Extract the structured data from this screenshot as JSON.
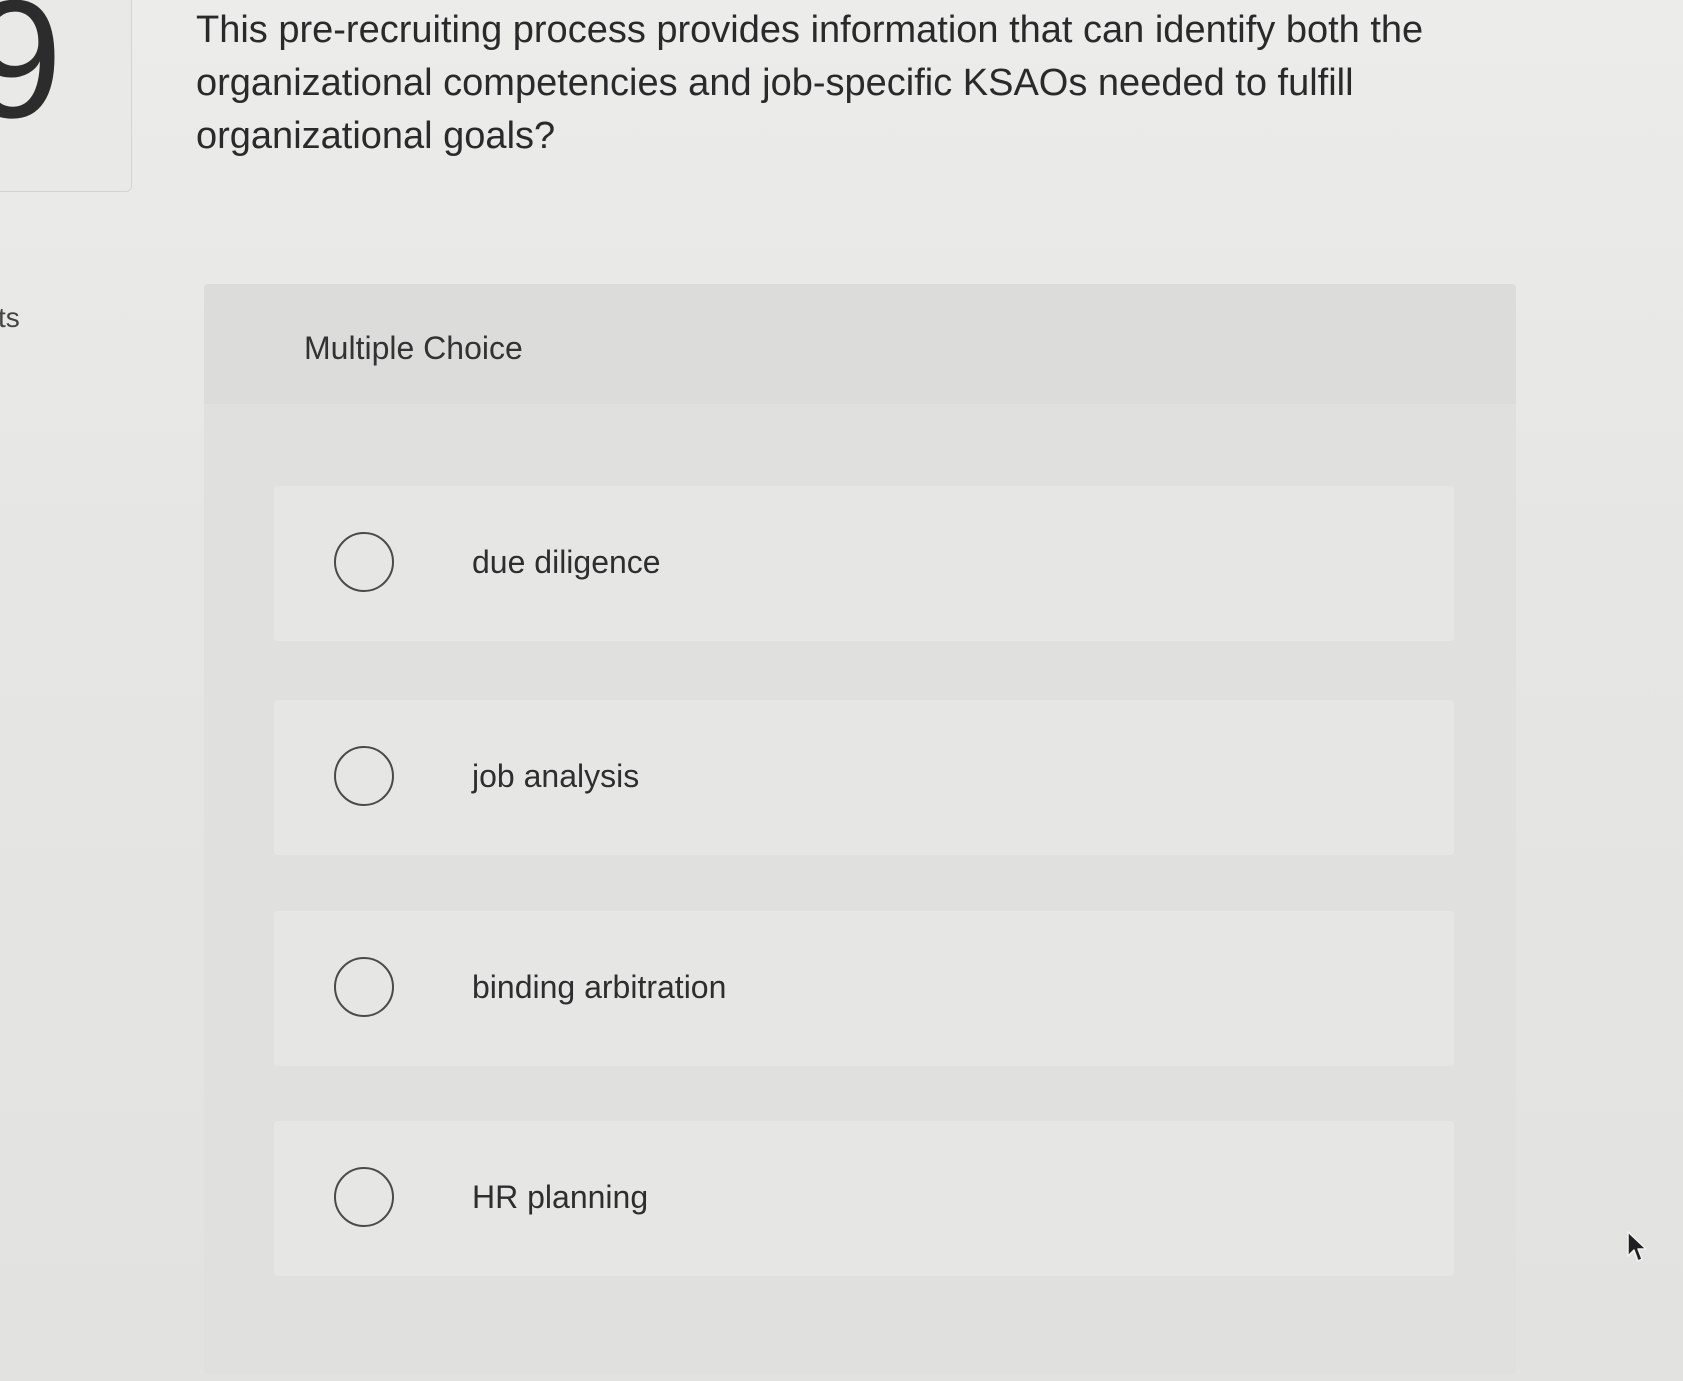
{
  "question_number": "9",
  "side_label": "ts",
  "question_text": "This pre-recruiting process provides information that can identify both the organizational competencies and job-specific KSAOs needed to fulfill organizational goals?",
  "question_type": "Multiple Choice",
  "options": [
    {
      "label": "due diligence",
      "selected": false
    },
    {
      "label": "job analysis",
      "selected": false
    },
    {
      "label": "binding arbitration",
      "selected": false
    },
    {
      "label": "HR planning",
      "selected": false
    }
  ],
  "icons": {
    "radio": "radio-button-icon",
    "cursor": "mouse-pointer-icon"
  }
}
